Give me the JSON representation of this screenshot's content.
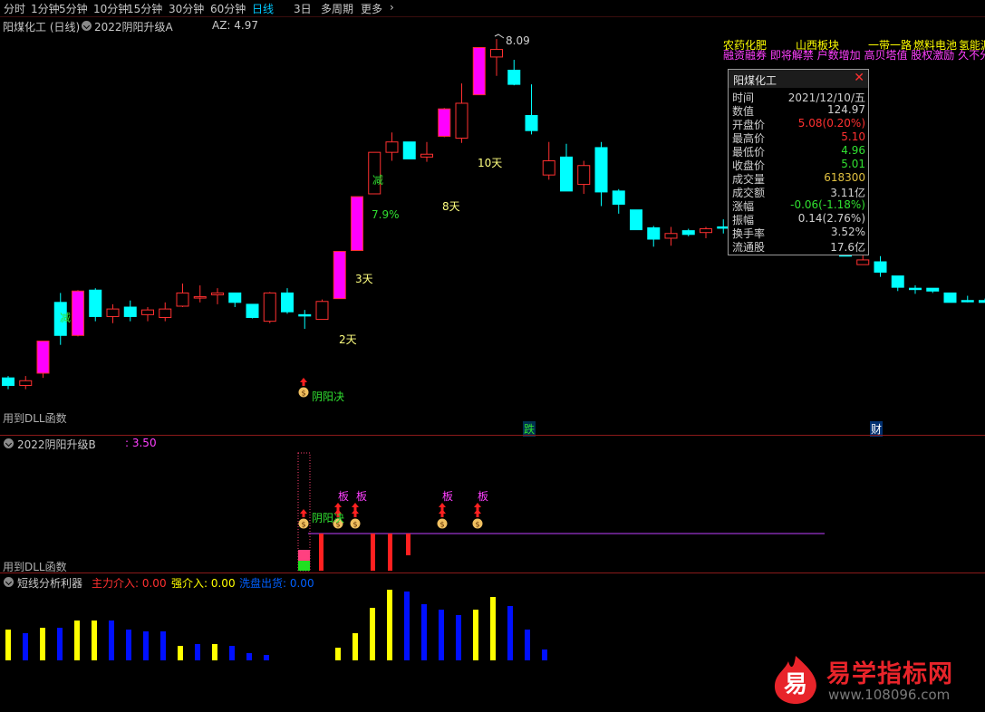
{
  "toolbar": {
    "items": [
      "分时",
      "1分钟",
      "5分钟",
      "10分钟",
      "15分钟",
      "30分钟",
      "60分钟",
      "日线",
      "3日",
      "多周期",
      "更多"
    ],
    "active": "日线"
  },
  "main_pane": {
    "stock_title": "阳煤化工 (日线)",
    "indicator_name": "2022阴阳升级A",
    "az_label": "AZ: 4.97",
    "peak_label": "8.09",
    "footer": "用到DLL函数",
    "annotations": {
      "jian1": "减",
      "jian2": "减",
      "pct": "7.9%",
      "d2": "2天",
      "d3": "3天",
      "d8": "8天",
      "d10": "10天",
      "yinyang": "阴阳决",
      "die": "跌",
      "cai": "财"
    },
    "news_row1": [
      "农药化肥",
      "山西板块",
      "一带一路",
      "燃料电池",
      "氢能源"
    ],
    "news_row2": "融资融券 即将解禁 户数增加 高贝塔值 股权激励 久不分红"
  },
  "info_box": {
    "title": "阳煤化工",
    "rows": [
      {
        "label": "时间",
        "value": "2021/12/10/五",
        "color": "#d0d0d0"
      },
      {
        "label": "数值",
        "value": "124.97",
        "color": "#d0d0d0"
      },
      {
        "label": "开盘价",
        "value": "5.08(0.20%)",
        "color": "#ff3030"
      },
      {
        "label": "最高价",
        "value": "5.10",
        "color": "#ff3030"
      },
      {
        "label": "最低价",
        "value": "4.96",
        "color": "#30e030"
      },
      {
        "label": "收盘价",
        "value": "5.01",
        "color": "#30e030"
      },
      {
        "label": "成交量",
        "value": "618300",
        "color": "#e0c040"
      },
      {
        "label": "成交额",
        "value": "3.11亿",
        "color": "#d0d0d0"
      },
      {
        "label": "涨幅",
        "value": "-0.06(-1.18%)",
        "color": "#30e030"
      },
      {
        "label": "振幅",
        "value": "0.14(2.76%)",
        "color": "#d0d0d0"
      },
      {
        "label": "换手率",
        "value": "3.52%",
        "color": "#d0d0d0"
      },
      {
        "label": "流通股",
        "value": "17.6亿",
        "color": "#d0d0d0"
      }
    ]
  },
  "pane_b": {
    "indicator_name": "2022阴阳升级B",
    "value_label": ": 3.50",
    "footer": "用到DLL函数",
    "ban_label": "板",
    "yinyang": "阴阳决"
  },
  "pane_c": {
    "indicator_name": "短线分析利器",
    "main_entry": "主力介入: 0.00",
    "strong_entry": "强介入: 0.00",
    "wash_exit": "洗盘出货: 0.00"
  },
  "watermark": {
    "logo_char": "易",
    "brand": "易学指标网",
    "url": "www.108096.com"
  },
  "colors": {
    "up": "#ff3030",
    "up_strong": "#ff00ff",
    "down": "#00ffff",
    "yellow": "#ffff00",
    "blue": "#0010ff",
    "pane_border": "#8b1a1a"
  },
  "chart_data": {
    "type": "candlestick",
    "series": "阳煤化工 daily OHLC",
    "candles": [
      {
        "o": 4.5,
        "c": 4.42,
        "h": 4.52,
        "l": 4.38,
        "k": "d"
      },
      {
        "o": 4.42,
        "c": 4.47,
        "h": 4.52,
        "l": 4.38,
        "k": "u"
      },
      {
        "o": 4.55,
        "c": 4.89,
        "h": 4.89,
        "l": 4.5,
        "k": "s"
      },
      {
        "o": 5.3,
        "c": 4.95,
        "h": 5.4,
        "l": 4.85,
        "k": "d"
      },
      {
        "o": 4.95,
        "c": 5.42,
        "h": 5.43,
        "l": 4.94,
        "k": "s"
      },
      {
        "o": 5.43,
        "c": 5.15,
        "h": 5.45,
        "l": 5.1,
        "k": "d"
      },
      {
        "o": 5.15,
        "c": 5.23,
        "h": 5.28,
        "l": 5.08,
        "k": "u"
      },
      {
        "o": 5.25,
        "c": 5.15,
        "h": 5.32,
        "l": 5.1,
        "k": "d"
      },
      {
        "o": 5.17,
        "c": 5.22,
        "h": 5.25,
        "l": 5.1,
        "k": "u"
      },
      {
        "o": 5.14,
        "c": 5.23,
        "h": 5.3,
        "l": 5.1,
        "k": "u"
      },
      {
        "o": 5.26,
        "c": 5.4,
        "h": 5.5,
        "l": 5.25,
        "k": "u"
      },
      {
        "o": 5.36,
        "c": 5.36,
        "h": 5.48,
        "l": 5.3,
        "k": "u"
      },
      {
        "o": 5.38,
        "c": 5.4,
        "h": 5.45,
        "l": 5.28,
        "k": "u"
      },
      {
        "o": 5.4,
        "c": 5.3,
        "h": 5.4,
        "l": 5.25,
        "k": "d"
      },
      {
        "o": 5.28,
        "c": 5.14,
        "h": 5.28,
        "l": 5.13,
        "k": "d"
      },
      {
        "o": 5.1,
        "c": 5.4,
        "h": 5.41,
        "l": 5.08,
        "k": "u"
      },
      {
        "o": 5.4,
        "c": 5.2,
        "h": 5.45,
        "l": 5.18,
        "k": "d"
      },
      {
        "o": 5.17,
        "c": 5.17,
        "h": 5.22,
        "l": 5.02,
        "k": "d"
      },
      {
        "o": 5.12,
        "c": 5.31,
        "h": 5.33,
        "l": 5.12,
        "k": "u"
      },
      {
        "o": 5.34,
        "c": 5.84,
        "h": 5.84,
        "l": 5.34,
        "k": "s"
      },
      {
        "o": 5.85,
        "c": 6.42,
        "h": 6.42,
        "l": 5.85,
        "k": "s"
      },
      {
        "o": 6.45,
        "c": 6.89,
        "h": 6.89,
        "l": 6.45,
        "k": "u"
      },
      {
        "o": 6.89,
        "c": 7.0,
        "h": 7.1,
        "l": 6.8,
        "k": "u"
      },
      {
        "o": 7.0,
        "c": 6.82,
        "h": 7.0,
        "l": 6.82,
        "k": "d"
      },
      {
        "o": 6.84,
        "c": 6.87,
        "h": 7.0,
        "l": 6.79,
        "k": "u"
      },
      {
        "o": 7.06,
        "c": 7.35,
        "h": 7.36,
        "l": 7.05,
        "k": "s"
      },
      {
        "o": 7.04,
        "c": 7.41,
        "h": 7.62,
        "l": 6.99,
        "k": "u"
      },
      {
        "o": 7.5,
        "c": 8.0,
        "h": 8.0,
        "l": 7.5,
        "k": "s"
      },
      {
        "o": 7.9,
        "c": 7.98,
        "h": 8.09,
        "l": 7.7,
        "k": "u"
      },
      {
        "o": 7.76,
        "c": 7.61,
        "h": 7.87,
        "l": 7.6,
        "k": "d"
      },
      {
        "o": 7.28,
        "c": 7.12,
        "h": 7.61,
        "l": 7.08,
        "k": "d"
      },
      {
        "o": 6.8,
        "c": 6.65,
        "h": 7.0,
        "l": 6.6,
        "k": "u"
      },
      {
        "o": 6.84,
        "c": 6.48,
        "h": 6.98,
        "l": 6.48,
        "k": "d"
      },
      {
        "o": 6.55,
        "c": 6.75,
        "h": 6.8,
        "l": 6.45,
        "k": "u"
      },
      {
        "o": 6.94,
        "c": 6.47,
        "h": 7.0,
        "l": 6.32,
        "k": "d"
      },
      {
        "o": 6.48,
        "c": 6.34,
        "h": 6.5,
        "l": 6.24,
        "k": "d"
      },
      {
        "o": 6.28,
        "c": 6.07,
        "h": 6.28,
        "l": 6.07,
        "k": "d"
      },
      {
        "o": 6.09,
        "c": 5.97,
        "h": 6.11,
        "l": 5.89,
        "k": "d"
      },
      {
        "o": 5.98,
        "c": 6.03,
        "h": 6.1,
        "l": 5.9,
        "k": "u"
      },
      {
        "o": 6.06,
        "c": 6.02,
        "h": 6.08,
        "l": 6.0,
        "k": "d"
      },
      {
        "o": 6.04,
        "c": 6.08,
        "h": 6.1,
        "l": 5.98,
        "k": "u"
      },
      {
        "o": 6.1,
        "c": 6.1,
        "h": 6.18,
        "l": 6.03,
        "k": "d"
      },
      {
        "o": 5.91,
        "c": 6.06,
        "h": 6.11,
        "l": 5.84,
        "k": "u"
      },
      {
        "o": 6.05,
        "c": 6.16,
        "h": 6.24,
        "l": 6.03,
        "k": "u"
      },
      {
        "o": 6.12,
        "c": 5.99,
        "h": 6.16,
        "l": 5.98,
        "k": "d"
      },
      {
        "o": 5.98,
        "c": 6.11,
        "h": 6.14,
        "l": 5.98,
        "k": "u"
      },
      {
        "o": 6.15,
        "c": 6.07,
        "h": 6.17,
        "l": 6.01,
        "k": "d"
      },
      {
        "o": 6.04,
        "c": 6.05,
        "h": 6.13,
        "l": 5.96,
        "k": "u"
      },
      {
        "o": 6.01,
        "c": 5.79,
        "h": 6.01,
        "l": 5.79,
        "k": "d"
      },
      {
        "o": 5.75,
        "c": 5.7,
        "h": 5.82,
        "l": 5.7,
        "k": "u"
      },
      {
        "o": 5.73,
        "c": 5.62,
        "h": 5.79,
        "l": 5.57,
        "k": "d"
      },
      {
        "o": 5.58,
        "c": 5.46,
        "h": 5.58,
        "l": 5.42,
        "k": "d"
      },
      {
        "o": 5.45,
        "c": 5.45,
        "h": 5.48,
        "l": 5.39,
        "k": "d"
      },
      {
        "o": 5.45,
        "c": 5.42,
        "h": 5.45,
        "l": 5.4,
        "k": "d"
      },
      {
        "o": 5.4,
        "c": 5.3,
        "h": 5.4,
        "l": 5.3,
        "k": "d"
      },
      {
        "o": 5.32,
        "c": 5.32,
        "h": 5.37,
        "l": 5.3,
        "k": "d"
      },
      {
        "o": 5.32,
        "c": 5.3,
        "h": 5.34,
        "l": 5.3,
        "k": "d"
      }
    ],
    "macd_like_bars": {
      "colors_sequence": [
        "y",
        "b",
        "y",
        "b",
        "y",
        "y",
        "b",
        "b",
        "b",
        "b",
        "y",
        "b",
        "y",
        "b",
        "b",
        "b",
        "y",
        "y",
        "y",
        "y",
        "b",
        "b",
        "b",
        "b",
        "y",
        "b",
        "y",
        "b"
      ],
      "heights": [
        0.35,
        0.3,
        0.35,
        0.35,
        0.45,
        0.45,
        0.45,
        0.32,
        0.32,
        0.32,
        0.18,
        0.18,
        0.18,
        0.18,
        0.18,
        0.1,
        0.18,
        0.3,
        0.78,
        1.0,
        1.0,
        0.8,
        0.72,
        0.65,
        0.72,
        0.85,
        0.68,
        0.45,
        0.14
      ]
    }
  }
}
